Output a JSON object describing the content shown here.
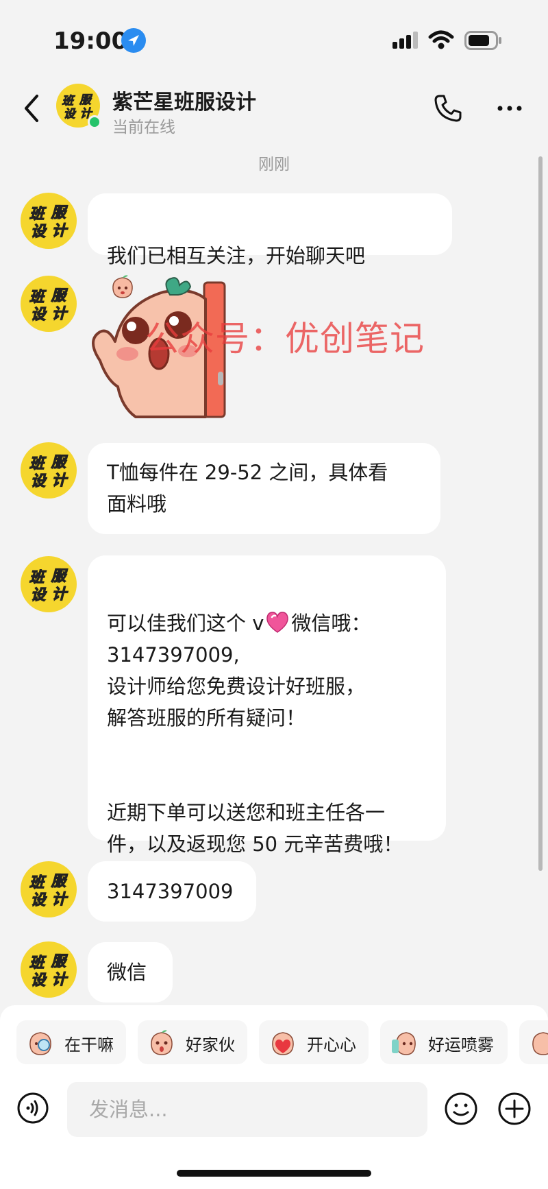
{
  "status_bar": {
    "time": "19:00"
  },
  "header": {
    "contact_name": "紫芒星班服设计",
    "contact_status": "当前在线",
    "avatar_text": [
      "班",
      "服",
      "设",
      "计"
    ]
  },
  "chat": {
    "timestamp": "刚刚",
    "messages": [
      {
        "text": "我们已相互关注，开始聊天吧"
      },
      {
        "type": "sticker"
      },
      {
        "text": "T恤每件在 29-52 之间，具体看\n面料哦"
      },
      {
        "text_a": "可以佳我们这个 v",
        "text_b": "微信哦：\n3147397009,\n设计师给您免费设计好班服，\n解答班服的所有疑问！\n\n\n近期下单可以送您和班主任各一\n件，以及返现您 50 元辛苦费哦！"
      },
      {
        "text": "3147397009"
      },
      {
        "text": "微信"
      }
    ],
    "watermark": "公众号：优创笔记"
  },
  "quick_replies": [
    "在干嘛",
    "好家伙",
    "开心心",
    "好运喷雾"
  ],
  "input": {
    "placeholder": "发消息..."
  },
  "colors": {
    "background": "#f3f3f3",
    "bubble": "#ffffff",
    "avatar_yellow": "#f5d62e",
    "online": "#25c26a",
    "watermark": "#e83c3c"
  }
}
